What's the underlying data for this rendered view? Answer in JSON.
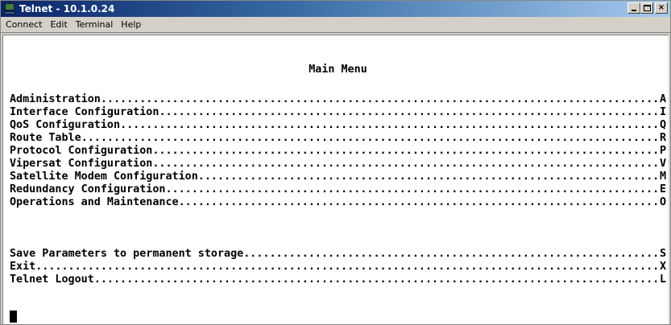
{
  "window": {
    "title": "Telnet - 10.1.0.24",
    "buttons": {
      "minimize": "_",
      "maximize": "□",
      "close": "×"
    }
  },
  "menubar": {
    "items": [
      "Connect",
      "Edit",
      "Terminal",
      "Help"
    ]
  },
  "terminal": {
    "heading": "Main Menu",
    "options": [
      {
        "label": "Administration",
        "key": "A"
      },
      {
        "label": "Interface Configuration",
        "key": "I"
      },
      {
        "label": "QoS Configuration",
        "key": "Q"
      },
      {
        "label": "Route Table",
        "key": "R"
      },
      {
        "label": "Protocol Configuration",
        "key": "P"
      },
      {
        "label": "Vipersat Configuration",
        "key": "V"
      },
      {
        "label": "Satellite Modem Configuration",
        "key": "M"
      },
      {
        "label": "Redundancy Configuration",
        "key": "E"
      },
      {
        "label": "Operations and Maintenance",
        "key": "O"
      }
    ],
    "extra_options": [
      {
        "label": "Save Parameters to permanent storage",
        "key": "S"
      },
      {
        "label": "Exit",
        "key": "X"
      },
      {
        "label": "Telnet Logout",
        "key": "L"
      }
    ]
  }
}
